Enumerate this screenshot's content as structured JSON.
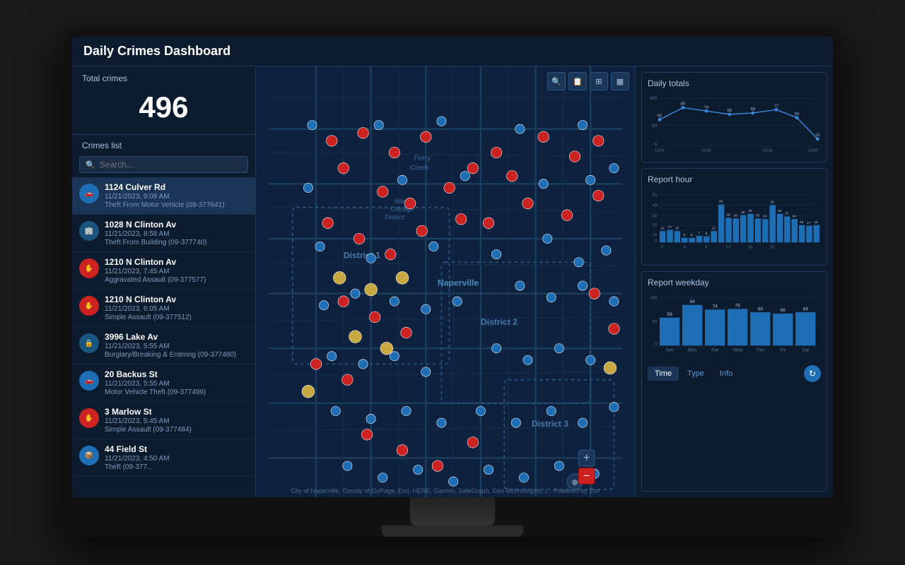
{
  "dashboard": {
    "title": "Daily Crimes Dashboard",
    "total_crimes_label": "Total crimes",
    "total_crimes_number": "496",
    "crimes_list_label": "Crimes list",
    "search_placeholder": "Search..."
  },
  "crimes": [
    {
      "id": 1,
      "address": "1124 Culver Rd",
      "date": "11/21/2023, 9:09 AM",
      "type": "Theft From Motor Vehicle (09-377641)",
      "icon_type": "vehicle",
      "icon_color": "#1e6eb5",
      "selected": true
    },
    {
      "id": 2,
      "address": "1028 N Clinton Av",
      "date": "11/21/2023, 8:58 AM",
      "type": "Theft From Building (09-377740)",
      "icon_type": "building",
      "icon_color": "#1a5580"
    },
    {
      "id": 3,
      "address": "1210 N Clinton Av",
      "date": "11/21/2023, 7:45 AM",
      "type": "Aggravated Assault (09-377577)",
      "icon_type": "assault",
      "icon_color": "#cc2222"
    },
    {
      "id": 4,
      "address": "1210 N Clinton Av",
      "date": "11/21/2023, 6:05 AM",
      "type": "Simple Assault (09-377512)",
      "icon_type": "simple_assault",
      "icon_color": "#cc2222"
    },
    {
      "id": 5,
      "address": "3996 Lake Av",
      "date": "11/21/2023, 5:55 AM",
      "type": "Burglary/Breaking & Entering (09-377480)",
      "icon_type": "burglary",
      "icon_color": "#1a5580"
    },
    {
      "id": 6,
      "address": "20 Backus St",
      "date": "11/21/2023, 5:55 AM",
      "type": "Motor Vehicle Theft (09-377499)",
      "icon_type": "vehicle_theft",
      "icon_color": "#1e6eb5"
    },
    {
      "id": 7,
      "address": "3 Marlow St",
      "date": "11/21/2023, 5:45 AM",
      "type": "Simple Assault (09-377484)",
      "icon_type": "simple_assault",
      "icon_color": "#cc2222"
    },
    {
      "id": 8,
      "address": "44 Field St",
      "date": "11/21/2023, 4:50 AM",
      "type": "Theft (09-377...",
      "icon_type": "theft",
      "icon_color": "#1e6eb5"
    }
  ],
  "charts": {
    "daily_totals": {
      "title": "Daily totals",
      "x_labels": [
        "11/14",
        "11/16",
        "11/18",
        "11/20"
      ],
      "data_points": [
        {
          "x": 0,
          "y": 55,
          "label": "55"
        },
        {
          "x": 1,
          "y": 80,
          "label": "80"
        },
        {
          "x": 2,
          "y": 74,
          "label": "74"
        },
        {
          "x": 3,
          "y": 66,
          "label": "66"
        },
        {
          "x": 4,
          "y": 69,
          "label": "69"
        },
        {
          "x": 5,
          "y": 77,
          "label": "77"
        },
        {
          "x": 6,
          "y": 59,
          "label": "59"
        },
        {
          "x": 7,
          "y": 16,
          "label": "16"
        }
      ],
      "y_max": 100,
      "y_labels": [
        "100",
        "50",
        "0"
      ]
    },
    "report_hour": {
      "title": "Report hour",
      "x_labels": [
        "0",
        "4",
        "8",
        "12",
        "16",
        "20"
      ],
      "bars": [
        {
          "label": "0",
          "value": 12
        },
        {
          "label": "",
          "value": 13
        },
        {
          "label": "",
          "value": 12
        },
        {
          "label": "4",
          "value": 5
        },
        {
          "label": "",
          "value": 5
        },
        {
          "label": "",
          "value": 7
        },
        {
          "label": "8",
          "value": 6
        },
        {
          "label": "",
          "value": 12
        },
        {
          "label": "",
          "value": 40
        },
        {
          "label": "12",
          "value": 26
        },
        {
          "label": "",
          "value": 25
        },
        {
          "label": "",
          "value": 29
        },
        {
          "label": "16",
          "value": 30
        },
        {
          "label": "",
          "value": 25
        },
        {
          "label": "",
          "value": 24
        },
        {
          "label": "20",
          "value": 39
        },
        {
          "label": "",
          "value": 30
        },
        {
          "label": "",
          "value": 27
        },
        {
          "label": "",
          "value": 24
        },
        {
          "label": "",
          "value": 18
        },
        {
          "label": "",
          "value": 17
        },
        {
          "label": "",
          "value": 18
        }
      ],
      "y_max": 50,
      "y_labels": [
        "50",
        "40",
        "30",
        "20",
        "10",
        "0"
      ]
    },
    "report_weekday": {
      "title": "Report weekday",
      "bars": [
        {
          "label": "Sun",
          "value": 58
        },
        {
          "label": "Mon",
          "value": 84
        },
        {
          "label": "Tue",
          "value": 74
        },
        {
          "label": "Wed",
          "value": 76
        },
        {
          "label": "Thu",
          "value": 69
        },
        {
          "label": "Fri",
          "value": 66
        },
        {
          "label": "Sat",
          "value": 69
        }
      ],
      "y_max": 100,
      "y_labels": [
        "100",
        "50",
        "0"
      ]
    }
  },
  "tabs": [
    "Time",
    "Type",
    "Info"
  ],
  "active_tab": "Time",
  "map": {
    "attribution": "City of Naperville, County of DuPage, Esri, HERE, Garmin, SafeGraph, GeoTechnologies, i... Powered by Esri",
    "tools": [
      "🔍",
      "📋",
      "⊞",
      "▦"
    ],
    "zoom_buttons": [
      "+",
      "−"
    ],
    "compass": "⊕"
  }
}
